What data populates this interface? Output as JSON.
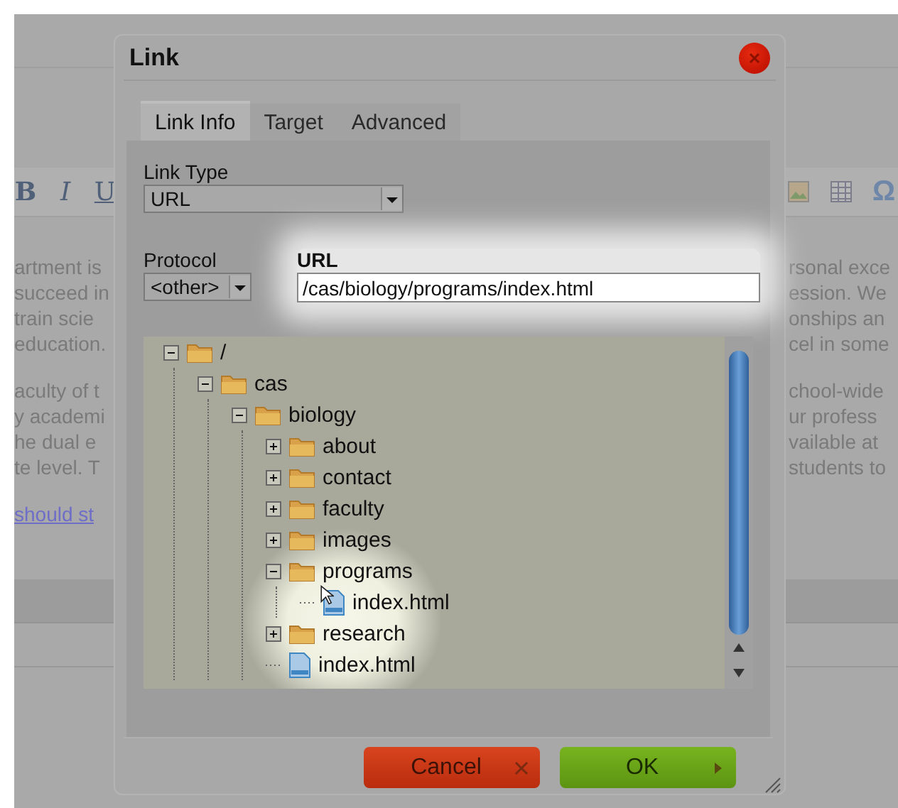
{
  "editor": {
    "format_buttons": [
      "B",
      "I",
      "U"
    ],
    "symbol_button": "Ω",
    "left_paragraphs": [
      [
        "artment is",
        "succeed in",
        "train scie",
        "education."
      ],
      [
        "aculty of t",
        "y academi",
        "he dual e",
        "te level. T"
      ]
    ],
    "left_link": "should st",
    "right_paragraphs": [
      [
        "rsonal exce",
        "ession. We",
        "onships an",
        "cel in some"
      ],
      [
        "chool-wide",
        "ur profess",
        "vailable at",
        "students to"
      ]
    ]
  },
  "dialog": {
    "title": "Link",
    "tabs": [
      {
        "label": "Link Info",
        "selected": true
      },
      {
        "label": "Target",
        "selected": false
      },
      {
        "label": "Advanced",
        "selected": false
      }
    ],
    "link_type": {
      "label": "Link Type",
      "value": "URL"
    },
    "protocol": {
      "label": "Protocol",
      "value": "<other>"
    },
    "url": {
      "label": "URL",
      "value": "/cas/biology/programs/index.html"
    },
    "tree": [
      {
        "label": "/",
        "kind": "folder",
        "expanded": true,
        "children": [
          {
            "label": "cas",
            "kind": "folder",
            "expanded": true,
            "children": [
              {
                "label": "biology",
                "kind": "folder",
                "expanded": true,
                "children": [
                  {
                    "label": "about",
                    "kind": "folder",
                    "expanded": false
                  },
                  {
                    "label": "contact",
                    "kind": "folder",
                    "expanded": false
                  },
                  {
                    "label": "faculty",
                    "kind": "folder",
                    "expanded": false
                  },
                  {
                    "label": "images",
                    "kind": "folder",
                    "expanded": false
                  },
                  {
                    "label": "programs",
                    "kind": "folder",
                    "expanded": true,
                    "children": [
                      {
                        "label": "index.html",
                        "kind": "file"
                      }
                    ]
                  },
                  {
                    "label": "research",
                    "kind": "folder",
                    "expanded": false
                  },
                  {
                    "label": "index.html",
                    "kind": "file"
                  }
                ]
              }
            ]
          }
        ]
      }
    ],
    "buttons": [
      {
        "label": "Cancel",
        "kind": "cancel"
      },
      {
        "label": "OK",
        "kind": "ok"
      }
    ]
  }
}
